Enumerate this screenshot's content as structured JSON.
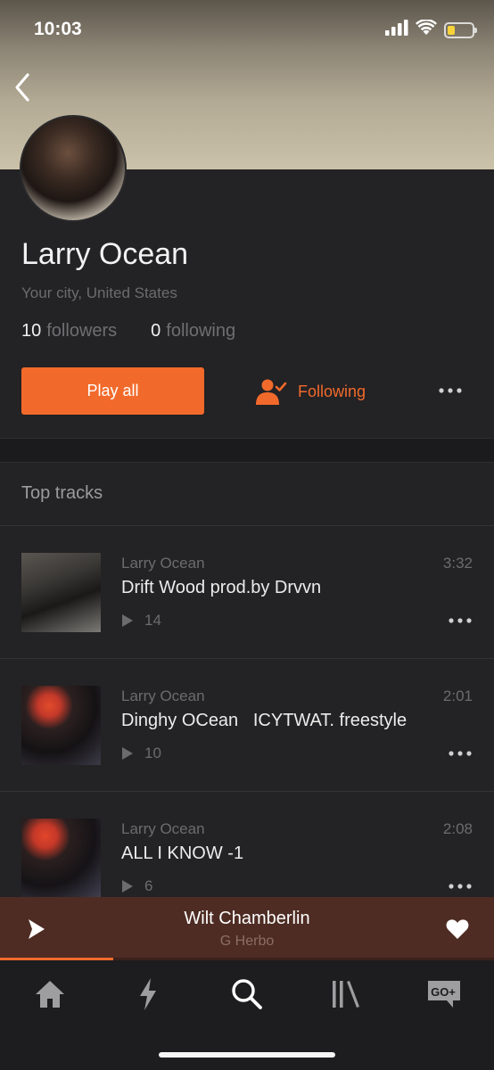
{
  "status_bar": {
    "time": "10:03",
    "battery_level": 0.3
  },
  "icons": {
    "back": "chevron-left-icon",
    "signal": "cellular-signal-icon",
    "wifi": "wifi-icon",
    "battery": "battery-icon",
    "following": "user-check-icon",
    "more": "more-horizontal-icon",
    "play": "play-icon",
    "heart": "heart-icon",
    "tabs": [
      "home-icon",
      "lightning-icon",
      "search-icon",
      "library-icon",
      "go-plus-icon"
    ]
  },
  "colors": {
    "accent": "#f26a2b",
    "background": "#232224",
    "mini_player": "#4e2c23",
    "tab_bar": "#1d1c1e"
  },
  "profile": {
    "name": "Larry Ocean",
    "location": "Your city, United States",
    "followers_count": "10",
    "followers_label": "followers",
    "following_count": "0",
    "following_label": "following"
  },
  "actions": {
    "play_all_label": "Play all",
    "following_label": "Following"
  },
  "top_tracks": {
    "title": "Top tracks",
    "items": [
      {
        "artist": "Larry Ocean",
        "title": "Drift Wood prod.by Drvvn",
        "duration": "3:32",
        "plays": "14"
      },
      {
        "artist": "Larry Ocean",
        "title": "Dinghy OCean   ICYTWAT. freestyle",
        "duration": "2:01",
        "plays": "10"
      },
      {
        "artist": "Larry Ocean",
        "title": "ALL I KNOW -1",
        "duration": "2:08",
        "plays": "6"
      }
    ]
  },
  "now_playing": {
    "title": "Wilt Chamberlin",
    "artist": "G Herbo",
    "progress": 0.23
  },
  "tab_bar": {
    "selected": "search",
    "go_plus_label": "GO+"
  }
}
